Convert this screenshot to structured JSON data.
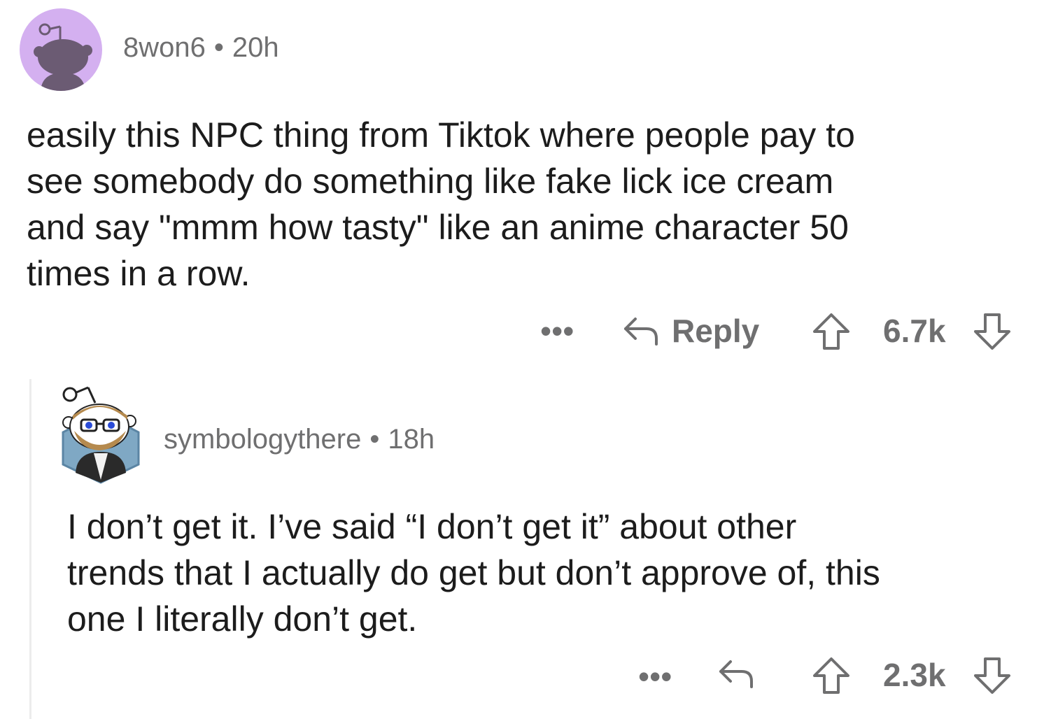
{
  "colors": {
    "avatar1_bg": "#d4b0f0",
    "meta_text": "#6f6f70",
    "body_text": "#1c1c1c",
    "thread_line": "#ececec"
  },
  "comments": [
    {
      "username": "8won6",
      "separator": "•",
      "time": "20h",
      "avatar_icon": "snoo-default-avatar",
      "body_lines": [
        "easily this NPC thing from Tiktok where people pay to",
        "see somebody do something like fake lick ice cream",
        "and say \"mmm how tasty\" like an anime character 50",
        "times in a row."
      ],
      "actions": {
        "more_label": "•••",
        "reply_label": "Reply",
        "score": "6.7k"
      }
    },
    {
      "username": "symbologythere",
      "separator": "•",
      "time": "18h",
      "avatar_icon": "snoo-custom-avatar-glasses",
      "body_lines": [
        "I don’t get it. I’ve said “I don’t get it” about other",
        "trends that I actually do get but don’t approve of, this",
        "one I literally don’t get."
      ],
      "actions": {
        "more_label": "•••",
        "score": "2.3k"
      }
    }
  ]
}
